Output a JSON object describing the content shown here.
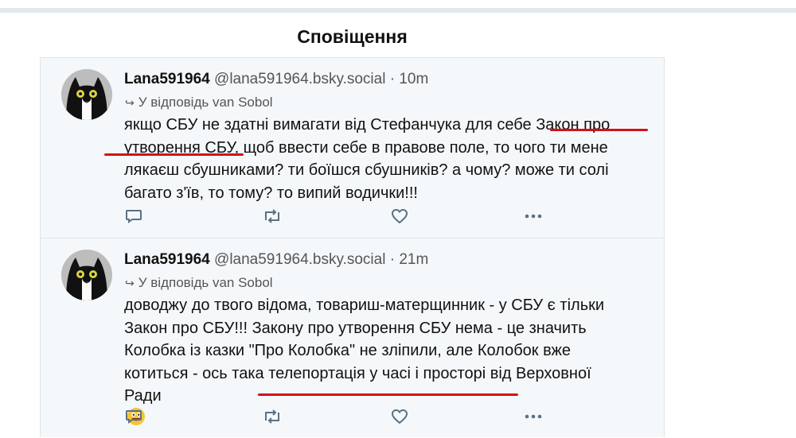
{
  "page": {
    "title": "Сповіщення"
  },
  "posts": [
    {
      "author": "Lana591964",
      "handle": "@lana591964.bsky.social",
      "sep": "·",
      "time": "10m",
      "reply_to": "У відповідь van Sobol",
      "lines": [
        "якщо СБУ не здатні вимагати від Стефанчука для себе Закон про",
        "утворення СБУ, щоб ввести себе в правове поле, то чого ти мене",
        "лякаєш сбушниками? ти боїшся сбушників? а чому? може ти солі",
        "багато з'їв, то тому? то випий водички!!!"
      ]
    },
    {
      "author": "Lana591964",
      "handle": "@lana591964.bsky.social",
      "sep": "·",
      "time": "21m",
      "reply_to": "У відповідь van Sobol",
      "lines": [
        "доводжу до твого відома, товариш-матерщинник - у СБУ є тільки",
        "Закон про СБУ!!! Закону про утворення СБУ нема - це значить",
        "Колобка із казки \"Про Колобка\" не зліпили, але Колобок вже",
        "котиться - ось така телепортація у часі і просторі від Верховної",
        "Ради"
      ],
      "emoji": "face-with-tongue"
    }
  ],
  "icons": {
    "reply": "speech-bubble-icon",
    "repost": "repost-arrows-icon",
    "like": "heart-icon",
    "more": "more-dots-icon"
  },
  "colors": {
    "annotation": "#d31119",
    "feed_bg": "#f5f8fa",
    "icon": "#5a7184"
  }
}
